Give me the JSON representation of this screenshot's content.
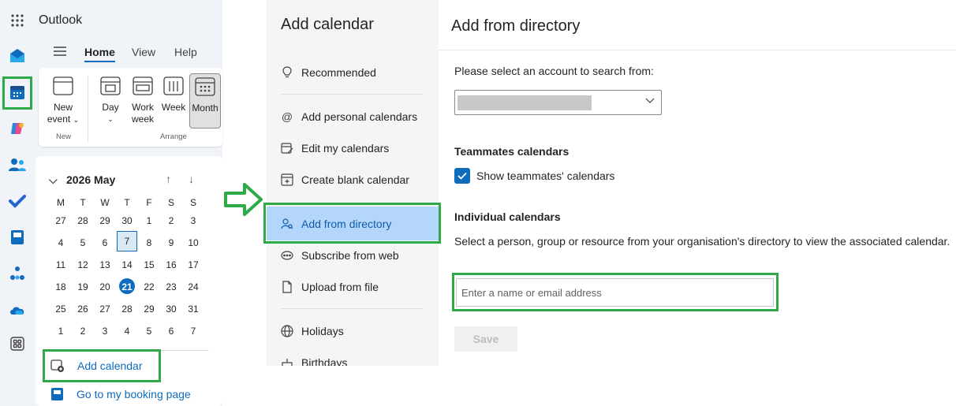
{
  "app": {
    "title": "Outlook"
  },
  "ribbon": {
    "tabs": [
      "Home",
      "View",
      "Help"
    ],
    "new_event": [
      "New",
      "event"
    ],
    "day": "Day",
    "work_week": [
      "Work",
      "week"
    ],
    "week": "Week",
    "month": "Month",
    "group_new": "New",
    "group_arrange": "Arrange"
  },
  "calendar": {
    "month_label": "2026 May",
    "weekdays": [
      "M",
      "T",
      "W",
      "T",
      "F",
      "S",
      "S"
    ],
    "weeks": [
      [
        "27",
        "28",
        "29",
        "30",
        "1",
        "2",
        "3"
      ],
      [
        "4",
        "5",
        "6",
        "7",
        "8",
        "9",
        "10"
      ],
      [
        "11",
        "12",
        "13",
        "14",
        "15",
        "16",
        "17"
      ],
      [
        "18",
        "19",
        "20",
        "21",
        "22",
        "23",
        "24"
      ],
      [
        "25",
        "26",
        "27",
        "28",
        "29",
        "30",
        "31"
      ],
      [
        "1",
        "2",
        "3",
        "4",
        "5",
        "6",
        "7"
      ]
    ],
    "selected_day": "7",
    "today": "21"
  },
  "links": {
    "add_calendar": "Add calendar",
    "booking_page": "Go to my booking page"
  },
  "add_calendar_panel": {
    "title": "Add calendar",
    "items": [
      "Recommended",
      "Add personal calendars",
      "Edit my calendars",
      "Create blank calendar",
      "Add from directory",
      "Subscribe from web",
      "Upload from file",
      "Holidays",
      "Birthdays"
    ]
  },
  "directory_panel": {
    "title": "Add from directory",
    "account_prompt": "Please select an account to search from:",
    "teammates_heading": "Teammates calendars",
    "teammates_checkbox": "Show teammates' calendars",
    "individual_heading": "Individual calendars",
    "individual_desc": "Select a person, group or resource from your organisation's directory to view the associated calendar.",
    "search_placeholder": "Enter a name or email address",
    "save_label": "Save"
  },
  "colors": {
    "highlight": "#2eab48",
    "accent": "#0f6cbd",
    "active_item": "#b4d6fa"
  }
}
